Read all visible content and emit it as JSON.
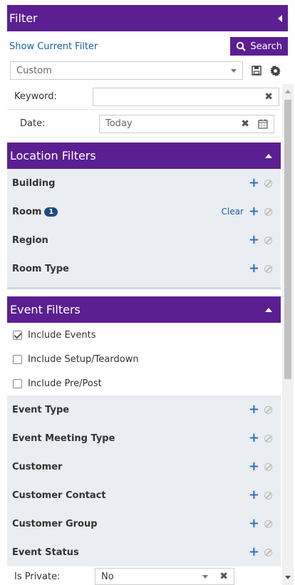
{
  "header": {
    "title": "Filter"
  },
  "toolbar": {
    "show_filter_label": "Show Current Filter",
    "search_label": "Search"
  },
  "saved_filter": {
    "value": "Custom"
  },
  "fields": {
    "keyword": {
      "label": "Keyword:",
      "value": ""
    },
    "date": {
      "label": "Date:",
      "value": "Today"
    }
  },
  "location": {
    "title": "Location Filters",
    "items": [
      {
        "label": "Building"
      },
      {
        "label": "Room",
        "badge": "1",
        "clear": "Clear"
      },
      {
        "label": "Region"
      },
      {
        "label": "Room Type"
      }
    ]
  },
  "event": {
    "title": "Event Filters",
    "checks": [
      {
        "label": "Include Events",
        "checked": true
      },
      {
        "label": "Include Setup/Teardown",
        "checked": false
      },
      {
        "label": "Include Pre/Post",
        "checked": false
      }
    ],
    "items": [
      {
        "label": "Event Type"
      },
      {
        "label": "Event Meeting Type"
      },
      {
        "label": "Customer"
      },
      {
        "label": "Customer Contact"
      },
      {
        "label": "Customer Group"
      },
      {
        "label": "Event Status"
      }
    ]
  },
  "private": {
    "label": "Is Private:",
    "value": "No"
  },
  "colors": {
    "accent": "#5b1f91",
    "link": "#1b5ea8",
    "panel": "#eaedf1"
  }
}
